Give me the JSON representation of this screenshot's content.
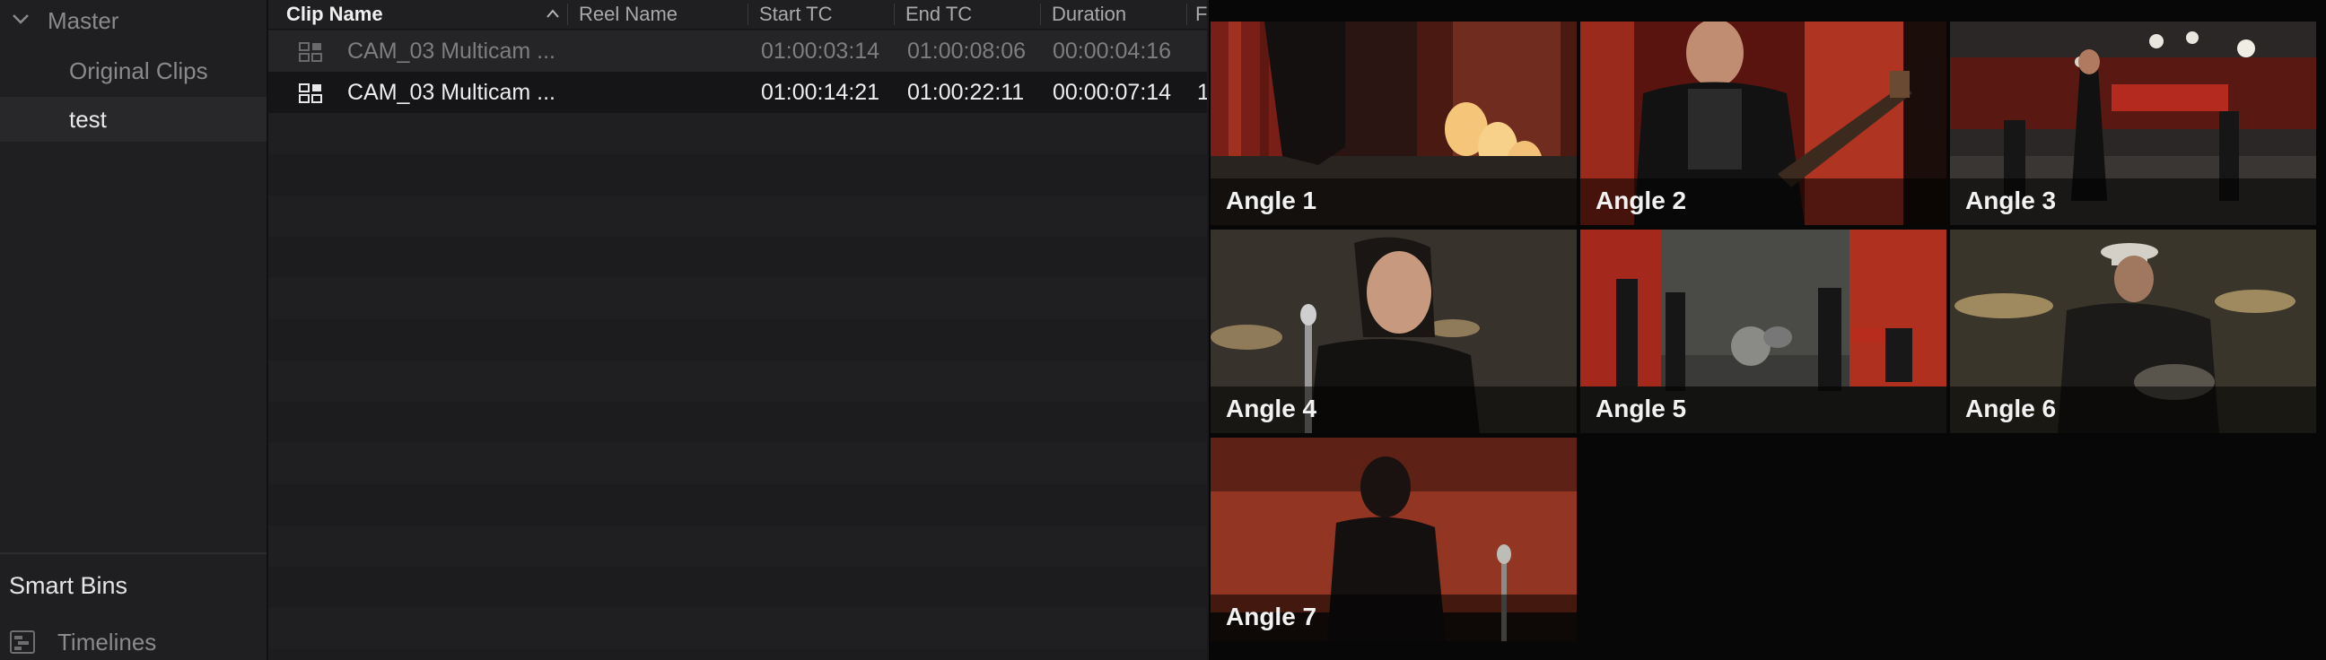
{
  "sidebar": {
    "master_label": "Master",
    "bins": [
      {
        "label": "Original Clips"
      },
      {
        "label": "test"
      }
    ],
    "smart_bins_label": "Smart Bins",
    "timelines_label": "Timelines"
  },
  "media_pool": {
    "columns": [
      "Clip Name",
      "Reel Name",
      "Start TC",
      "End TC",
      "Duration",
      "F"
    ],
    "rows": [
      {
        "clip_name": "CAM_03 Multicam ...",
        "reel_name": "",
        "start_tc": "01:00:03:14",
        "end_tc": "01:00:08:06",
        "duration": "00:00:04:16",
        "f": ""
      },
      {
        "clip_name": "CAM_03 Multicam ...",
        "reel_name": "",
        "start_tc": "01:00:14:21",
        "end_tc": "01:00:22:11",
        "duration": "00:00:07:14",
        "f": "1"
      }
    ]
  },
  "viewer": {
    "angles": [
      {
        "label": "Angle 1"
      },
      {
        "label": "Angle 2"
      },
      {
        "label": "Angle 3"
      },
      {
        "label": "Angle 4"
      },
      {
        "label": "Angle 5",
        "selected": true
      },
      {
        "label": "Angle 6"
      },
      {
        "label": "Angle 7"
      }
    ],
    "selection_color": "#e2473c"
  }
}
